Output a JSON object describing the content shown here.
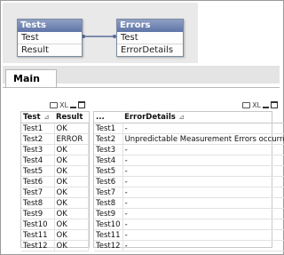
{
  "model": {
    "tables": [
      {
        "name": "Tests",
        "fields": [
          "Test",
          "Result"
        ]
      },
      {
        "name": "Errors",
        "fields": [
          "Test",
          "ErrorDetails"
        ]
      }
    ]
  },
  "tabs": [
    {
      "label": "Main"
    }
  ],
  "caption_icons": {
    "xl": "XL"
  },
  "left_table": {
    "headers": [
      "Test",
      "Result"
    ],
    "rows": [
      [
        "Test1",
        "OK"
      ],
      [
        "Test2",
        "ERROR"
      ],
      [
        "Test3",
        "OK"
      ],
      [
        "Test4",
        "OK"
      ],
      [
        "Test5",
        "OK"
      ],
      [
        "Test6",
        "OK"
      ],
      [
        "Test7",
        "OK"
      ],
      [
        "Test8",
        "OK"
      ],
      [
        "Test9",
        "OK"
      ],
      [
        "Test10",
        "OK"
      ],
      [
        "Test11",
        "OK"
      ],
      [
        "Test12",
        "OK"
      ]
    ]
  },
  "right_table": {
    "headers": [
      "...",
      "ErrorDetails"
    ],
    "rows": [
      [
        "Test1",
        "-"
      ],
      [
        "Test2",
        "Unpredictable Measurement Errors occurred"
      ],
      [
        "Test3",
        "-"
      ],
      [
        "Test4",
        "-"
      ],
      [
        "Test5",
        "-"
      ],
      [
        "Test6",
        "-"
      ],
      [
        "Test7",
        "-"
      ],
      [
        "Test8",
        "-"
      ],
      [
        "Test9",
        "-"
      ],
      [
        "Test10",
        "-"
      ],
      [
        "Test11",
        "-"
      ],
      [
        "Test12",
        "-"
      ]
    ]
  }
}
